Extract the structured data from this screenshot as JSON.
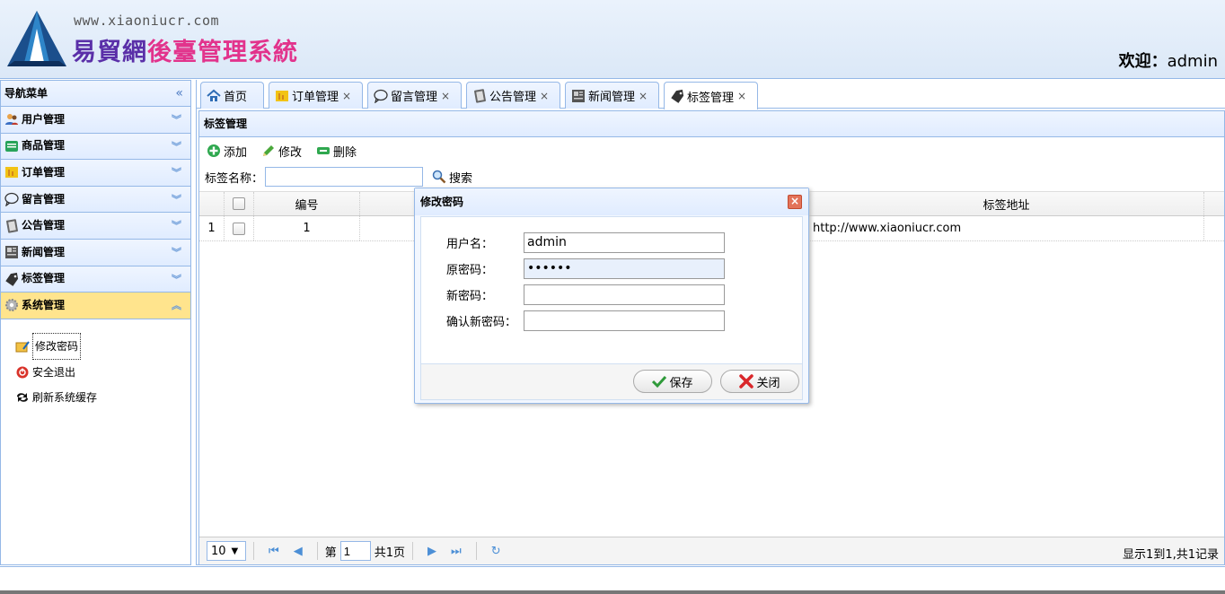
{
  "header": {
    "site_url": "www.xiaoniucr.com",
    "title_part1": "易貿網",
    "title_part2": "後臺管理系統",
    "welcome_label": "欢迎：",
    "username": "admin"
  },
  "sidebar": {
    "title": "导航菜单",
    "collapse_icon": "double-chevron-left-icon",
    "items": [
      {
        "label": "用户管理",
        "icon": "users-icon"
      },
      {
        "label": "商品管理",
        "icon": "goods-icon"
      },
      {
        "label": "订单管理",
        "icon": "order-icon"
      },
      {
        "label": "留言管理",
        "icon": "speech-bubble-icon"
      },
      {
        "label": "公告管理",
        "icon": "notebook-icon"
      },
      {
        "label": "新闻管理",
        "icon": "newspaper-icon"
      },
      {
        "label": "标签管理",
        "icon": "tag-icon"
      },
      {
        "label": "系统管理",
        "icon": "gear-icon"
      }
    ],
    "sub_items": [
      {
        "label": "修改密码",
        "icon": "edit-password-icon"
      },
      {
        "label": "安全退出",
        "icon": "power-icon"
      },
      {
        "label": "刷新系统缓存",
        "icon": "refresh-arrows-icon"
      }
    ]
  },
  "tabs": [
    {
      "label": "首页"
    },
    {
      "label": "订单管理"
    },
    {
      "label": "留言管理"
    },
    {
      "label": "公告管理"
    },
    {
      "label": "新闻管理"
    },
    {
      "label": "标签管理"
    }
  ],
  "content": {
    "title": "标签管理",
    "toolbar": {
      "add": "添加",
      "edit": "修改",
      "delete": "删除"
    },
    "search_label": "标签名称：",
    "search_value": "",
    "search_button": "搜索",
    "columns": [
      "编号",
      "标签地址"
    ],
    "rows": [
      {
        "index": "1",
        "id": "1",
        "url": "http://www.xiaoniucr.com"
      }
    ]
  },
  "pager": {
    "page_size": "10",
    "page_prefix": "第",
    "page_value": "1",
    "page_total": "共1页",
    "info": "显示1到1,共1记录"
  },
  "dialog": {
    "title": "修改密码",
    "username_label": "用户名：",
    "username_value": "admin",
    "old_password_label": "原密码：",
    "old_password_value": "••••••",
    "new_password_label": "新密码：",
    "new_password_value": "",
    "confirm_password_label": "确认新密码：",
    "confirm_password_value": "",
    "save_button": "保存",
    "close_button": "关闭"
  },
  "colors": {
    "border": "#95b8e7",
    "selected": "#ffe48d",
    "title_purple": "#5a2fa8",
    "title_pink": "#e2338c"
  }
}
